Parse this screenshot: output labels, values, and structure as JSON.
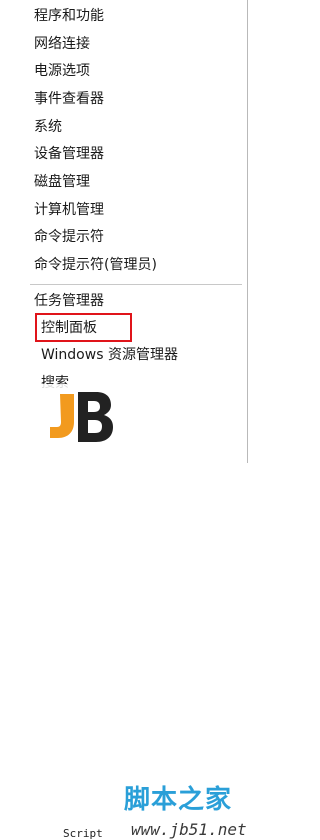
{
  "menu": {
    "items": [
      {
        "label": "程序和功能"
      },
      {
        "label": "网络连接"
      },
      {
        "label": "电源选项"
      },
      {
        "label": "事件查看器"
      },
      {
        "label": "系统"
      },
      {
        "label": "设备管理器"
      },
      {
        "label": "磁盘管理"
      },
      {
        "label": "计算机管理"
      },
      {
        "label": "命令提示符"
      },
      {
        "label": "命令提示符(管理员)"
      },
      {
        "label": "任务管理器"
      },
      {
        "label": "控制面板"
      },
      {
        "label": "Windows 资源管理器"
      },
      {
        "label": "搜索"
      }
    ]
  },
  "colors": {
    "highlight_border": "#e0141a",
    "watermark_blue": "#2a9fd8",
    "watermark_orange": "#f29a1e"
  },
  "watermark": {
    "script": "Script",
    "title": "脚本之家",
    "url": "www.jb51.net"
  }
}
